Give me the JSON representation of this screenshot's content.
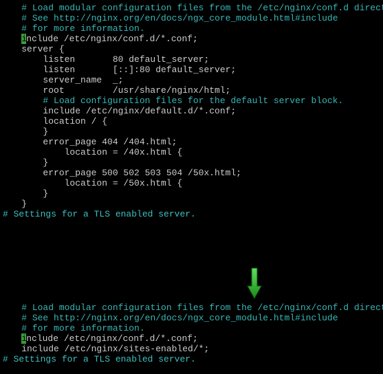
{
  "top": {
    "c1": "# Load modular configuration files from the /etc/nginx/conf.d directory.",
    "c2": "# See http://nginx.org/en/docs/ngx_core_module.html#include",
    "c3": "# for more information.",
    "cursor_char": "i",
    "include_rest": "nclude /etc/nginx/conf.d/*.conf;",
    "blank1": "",
    "l_server": "    server {",
    "l_listen1": "        listen       80 default_server;",
    "l_listen2": "        listen       [::]:80 default_server;",
    "l_sname": "        server_name  _;",
    "l_root": "        root         /usr/share/nginx/html;",
    "blank2": "",
    "c4": "        # Load configuration files for the default server block.",
    "l_inc2": "        include /etc/nginx/default.d/*.conf;",
    "blank3": "",
    "l_loc": "        location / {",
    "l_cb1": "        }",
    "blank4": "",
    "l_err1": "        error_page 404 /404.html;",
    "l_err1b": "            location = /40x.html {",
    "l_cb2": "        }",
    "blank5": "",
    "l_err2": "        error_page 500 502 503 504 /50x.html;",
    "l_err2b": "            location = /50x.html {",
    "l_cb3": "        }",
    "l_cb4": "    }",
    "blank6": "",
    "section": "# Settings for a TLS enabled server."
  },
  "bottom": {
    "c1": "# Load modular configuration files from the /etc/nginx/conf.d directory.",
    "c2": "# See http://nginx.org/en/docs/ngx_core_module.html#include",
    "c3": "# for more information.",
    "cursor_char": "i",
    "include_rest": "nclude /etc/nginx/conf.d/*.conf;",
    "l_inc_sites": "    include /etc/nginx/sites-enabled/*;",
    "blank": "",
    "section": "# Settings for a TLS enabled server."
  }
}
